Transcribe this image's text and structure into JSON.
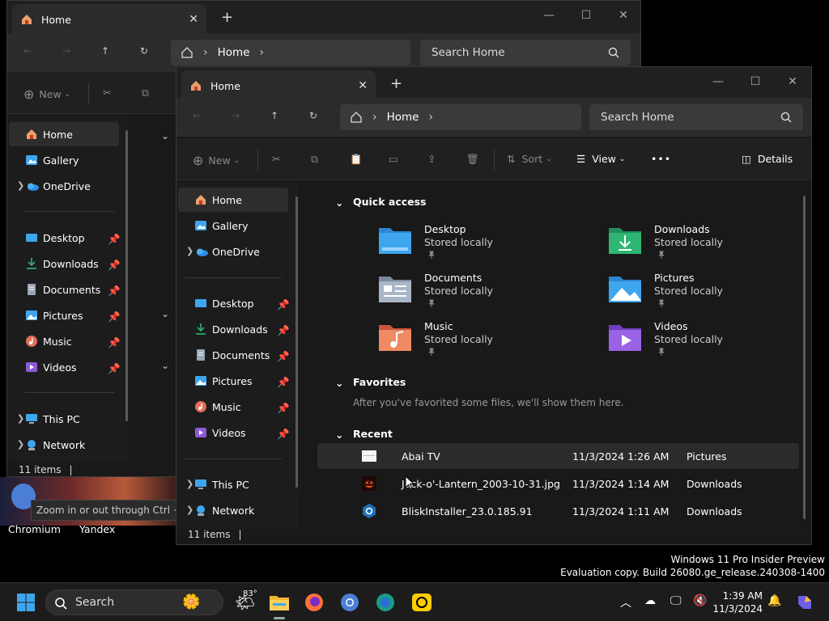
{
  "back_window": {
    "tab_title": "Home",
    "address": {
      "crumb": "Home"
    },
    "search_placeholder": "Search Home",
    "new_label": "New",
    "sidebar": [
      {
        "label": "Home",
        "icon": "home-icon"
      },
      {
        "label": "Gallery",
        "icon": "gallery-icon"
      },
      {
        "label": "OneDrive",
        "icon": "onedrive-icon"
      },
      {
        "label": "Desktop",
        "icon": "desktop-icon"
      },
      {
        "label": "Downloads",
        "icon": "downloads-icon"
      },
      {
        "label": "Documents",
        "icon": "documents-icon"
      },
      {
        "label": "Pictures",
        "icon": "pictures-icon"
      },
      {
        "label": "Music",
        "icon": "music-icon"
      },
      {
        "label": "Videos",
        "icon": "videos-icon"
      },
      {
        "label": "This PC",
        "icon": "pc-icon"
      },
      {
        "label": "Network",
        "icon": "network-icon"
      }
    ],
    "status": "11 items"
  },
  "front_window": {
    "tab_title": "Home",
    "address": {
      "crumb": "Home"
    },
    "search_placeholder": "Search Home",
    "toolbar": {
      "new_label": "New",
      "sort_label": "Sort",
      "view_label": "View",
      "more_label": "•••",
      "details_label": "Details"
    },
    "sidebar": [
      {
        "label": "Home",
        "icon": "home-icon"
      },
      {
        "label": "Gallery",
        "icon": "gallery-icon"
      },
      {
        "label": "OneDrive",
        "icon": "onedrive-icon"
      },
      {
        "label": "Desktop",
        "icon": "desktop-icon"
      },
      {
        "label": "Downloads",
        "icon": "downloads-icon"
      },
      {
        "label": "Documents",
        "icon": "documents-icon"
      },
      {
        "label": "Pictures",
        "icon": "pictures-icon"
      },
      {
        "label": "Music",
        "icon": "music-icon"
      },
      {
        "label": "Videos",
        "icon": "videos-icon"
      },
      {
        "label": "This PC",
        "icon": "pc-icon"
      },
      {
        "label": "Network",
        "icon": "network-icon"
      }
    ],
    "quick_access": {
      "title": "Quick access",
      "items": [
        {
          "name": "Desktop",
          "status": "Stored locally",
          "icon": "desktop-folder-icon"
        },
        {
          "name": "Downloads",
          "status": "Stored locally",
          "icon": "downloads-folder-icon"
        },
        {
          "name": "Documents",
          "status": "Stored locally",
          "icon": "documents-folder-icon"
        },
        {
          "name": "Pictures",
          "status": "Stored locally",
          "icon": "pictures-folder-icon"
        },
        {
          "name": "Music",
          "status": "Stored locally",
          "icon": "music-folder-icon"
        },
        {
          "name": "Videos",
          "status": "Stored locally",
          "icon": "videos-folder-icon"
        }
      ]
    },
    "favorites": {
      "title": "Favorites",
      "empty_text": "After you've favorited some files, we'll show them here."
    },
    "recent": {
      "title": "Recent",
      "rows": [
        {
          "name": "Abai TV",
          "date": "11/3/2024 1:26 AM",
          "location": "Pictures"
        },
        {
          "name": "Jack-o'-Lantern_2003-10-31.jpg",
          "date": "11/3/2024 1:14 AM",
          "location": "Downloads"
        },
        {
          "name": "BliskInstaller_23.0.185.91",
          "date": "11/3/2024 1:11 AM",
          "location": "Downloads"
        }
      ]
    },
    "status": "11 items"
  },
  "desktop": {
    "icons": [
      {
        "label": "Chromium"
      },
      {
        "label": "Yandex"
      }
    ],
    "tooltip": "Zoom in or out through Ctrl + m",
    "watermark_line1": "Windows 11 Pro Insider Preview",
    "watermark_line2": "Evaluation copy. Build 26080.ge_release.240308-1400"
  },
  "taskbar": {
    "search_label": "Search",
    "weather_temp": "83°",
    "time": "1:39 AM",
    "date": "11/3/2024"
  },
  "colors": {
    "folder_blue": "#3ea6ef",
    "accent": "#4cc2ff",
    "download_green": "#2fb673"
  }
}
